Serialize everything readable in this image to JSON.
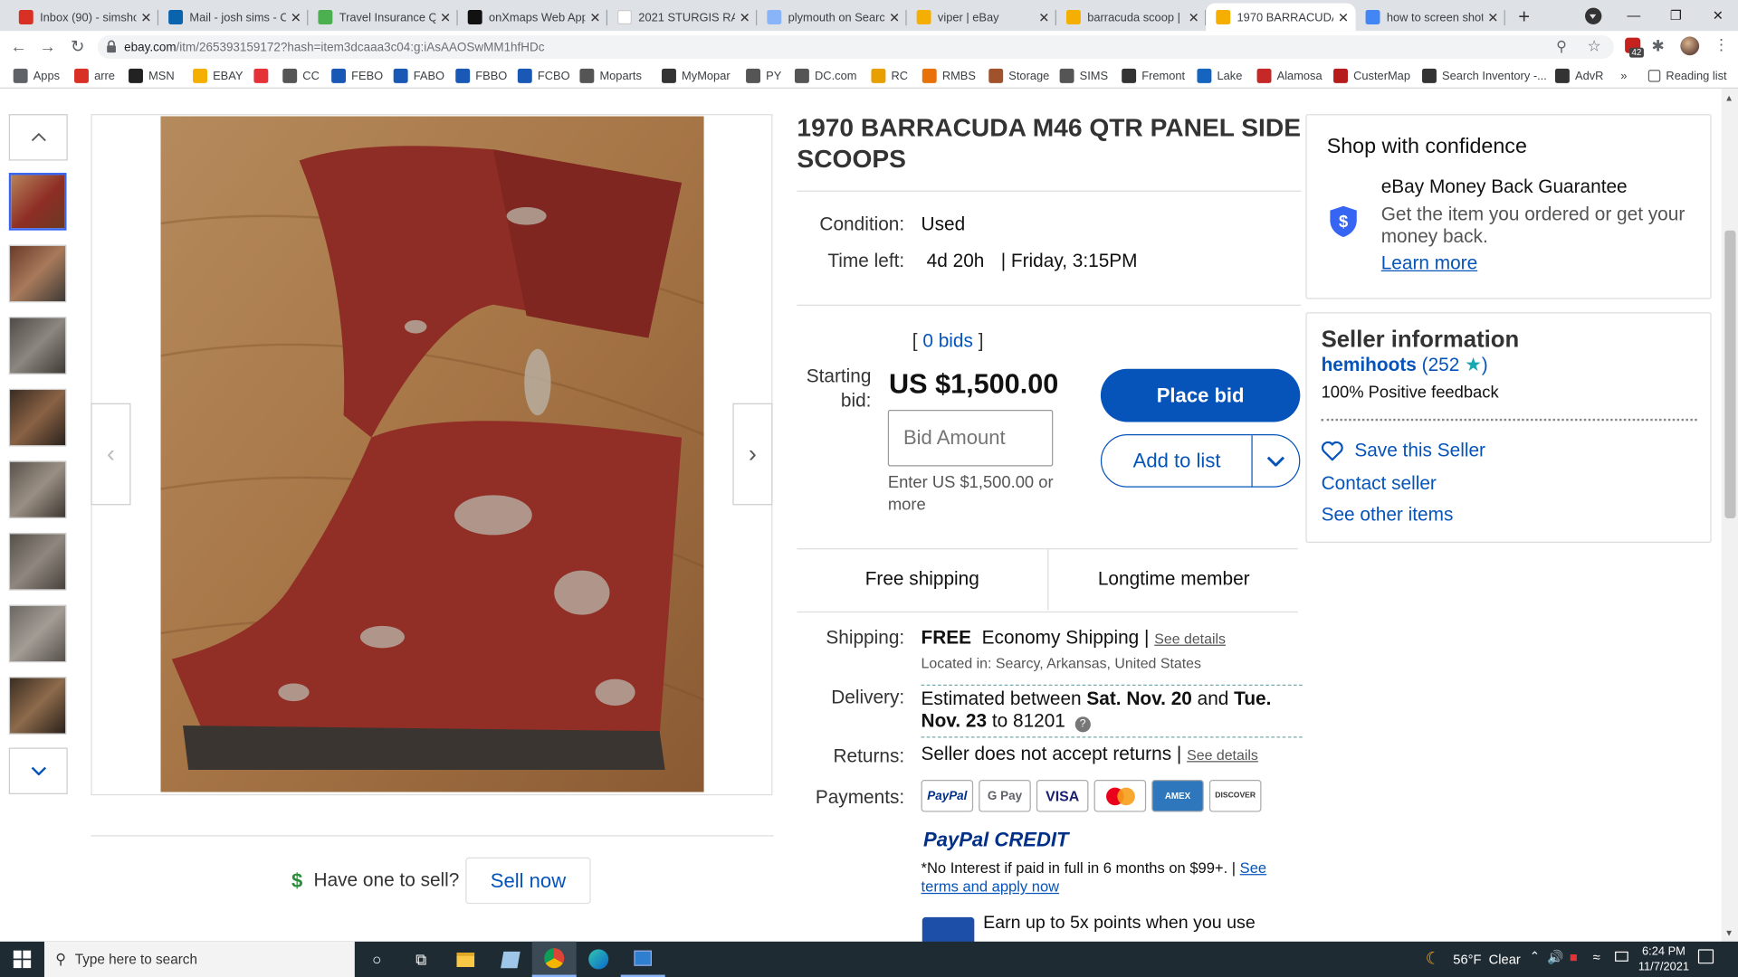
{
  "browser": {
    "tabs": [
      {
        "title": "Inbox (90) - simsho",
        "favicon": "gmail-icon",
        "color": "#d93025"
      },
      {
        "title": "Mail - josh sims - O",
        "favicon": "outlook-icon",
        "color": "#0a64ad"
      },
      {
        "title": "Travel Insurance Q",
        "favicon": "insurance-icon",
        "color": "#4caf50"
      },
      {
        "title": "onXmaps Web App",
        "favicon": "onx-icon",
        "color": "#111111"
      },
      {
        "title": "2021 STURGIS RAL",
        "favicon": "blank-icon",
        "color": "#ffffff"
      },
      {
        "title": "plymouth on Searc",
        "favicon": "search-icon",
        "color": "#8ab4f8"
      },
      {
        "title": "viper | eBay",
        "favicon": "ebay-bag-icon",
        "color": "#f5af02"
      },
      {
        "title": "barracuda scoop |",
        "favicon": "ebay-bag-icon",
        "color": "#f5af02"
      },
      {
        "title": "1970 BARRACUDA",
        "favicon": "ebay-bag-icon",
        "color": "#f5af02"
      },
      {
        "title": "how to screen shot",
        "favicon": "google-icon",
        "color": "#4285f4"
      }
    ],
    "new_tab_label": "+",
    "url_domain": "ebay.com",
    "url_rest": "/itm/265393159172?hash=item3dcaaa3c04:g:iAsAAOSwMM1hfHDc",
    "extension_badge": "42",
    "bookmarks": [
      {
        "label": "Apps",
        "icon": "apps-grid-icon",
        "color": "#5f6368"
      },
      {
        "label": "arre",
        "icon": "gmail-icon",
        "color": "#d93025"
      },
      {
        "label": "MSN",
        "icon": "msn-icon",
        "color": "#222222"
      },
      {
        "label": "EBAY",
        "icon": "ebay-bag-icon",
        "color": "#f5af02"
      },
      {
        "label": "",
        "icon": "e-red-icon",
        "color": "#e53238"
      },
      {
        "label": "CC",
        "icon": "globe-icon",
        "color": "#555555"
      },
      {
        "label": "FEBO",
        "icon": "fb-icon",
        "color": "#1a58b6"
      },
      {
        "label": "FABO",
        "icon": "fb-icon",
        "color": "#1a58b6"
      },
      {
        "label": "FBBO",
        "icon": "fb-icon",
        "color": "#1a58b6"
      },
      {
        "label": "FCBO",
        "icon": "fb-icon",
        "color": "#1a58b6"
      },
      {
        "label": "Moparts",
        "icon": "globe-icon",
        "color": "#555555"
      },
      {
        "label": "MyMopar",
        "icon": "mopar-icon",
        "color": "#333333"
      },
      {
        "label": "PY",
        "icon": "globe-icon",
        "color": "#555555"
      },
      {
        "label": "DC.com",
        "icon": "globe-icon",
        "color": "#555555"
      },
      {
        "label": "RC",
        "icon": "rc-icon",
        "color": "#e8a000"
      },
      {
        "label": "RMBS",
        "icon": "rmbs-icon",
        "color": "#e8710a"
      },
      {
        "label": "Storage",
        "icon": "storage-icon",
        "color": "#a0522d"
      },
      {
        "label": "SIMS",
        "icon": "globe-icon",
        "color": "#555555"
      },
      {
        "label": "Fremont",
        "icon": "fremont-icon",
        "color": "#333333"
      },
      {
        "label": "Lake",
        "icon": "lake-icon",
        "color": "#1565c0"
      },
      {
        "label": "Alamosa",
        "icon": "alamosa-icon",
        "color": "#c62828"
      },
      {
        "label": "CusterMap",
        "icon": "custer-icon",
        "color": "#b71c1c"
      },
      {
        "label": "Search Inventory -...",
        "icon": "inventory-icon",
        "color": "#333333"
      },
      {
        "label": "AdvR",
        "icon": "advr-icon",
        "color": "#333333"
      }
    ],
    "bookmarks_more": "»",
    "reading_list": "Reading list"
  },
  "listing": {
    "title": "1970 BARRACUDA M46 QTR PANEL SIDE SCOOPS",
    "condition_label": "Condition:",
    "condition_value": "Used",
    "timeleft_label": "Time left:",
    "timeleft_value": "4d 20h",
    "timeleft_end": "| Friday, 3:15PM",
    "bids_open": "[",
    "bids_text": "0 bids",
    "bids_close": "]",
    "starting_bid_label_1": "Starting",
    "starting_bid_label_2": "bid:",
    "price": "US $1,500.00",
    "bid_placeholder": "Bid Amount",
    "bid_hint": "Enter US $1,500.00 or more",
    "place_bid": "Place bid",
    "add_to_list": "Add to list",
    "free_shipping": "Free shipping",
    "longtime_member": "Longtime member",
    "shipping_label": "Shipping:",
    "shipping_free": "FREE",
    "shipping_method": "Economy Shipping |",
    "see_details": "See details",
    "located_in": "Located in:  Searcy, Arkansas, United States",
    "delivery_label": "Delivery:",
    "delivery_pre": "Estimated between ",
    "delivery_start": "Sat. Nov. 20",
    "delivery_and": " and ",
    "delivery_end": "Tue. Nov. 23",
    "delivery_to": " to 81201",
    "returns_label": "Returns:",
    "returns_value": "Seller does not accept returns |",
    "returns_see": "See details",
    "payments_label": "Payments:",
    "payment_methods": [
      "PayPal",
      "G Pay",
      "VISA",
      "MC",
      "AMEX",
      "DISCOVER"
    ],
    "paypal_credit": "PayPal CREDIT",
    "paypal_credit_note": "*No Interest if paid in full in 6 months on $99+. |",
    "see_terms": "See terms and apply now",
    "earn_points": "Earn up to 5x points when you use"
  },
  "gallery": {
    "thumb_count": 8,
    "have_one": "Have one to sell?",
    "sell_now": "Sell now"
  },
  "confidence": {
    "heading": "Shop with confidence",
    "guarantee_title": "eBay Money Back Guarantee",
    "guarantee_text": "Get the item you ordered or get your money back.",
    "learn_more": "Learn more"
  },
  "seller": {
    "heading": "Seller information",
    "name": "hemihoots",
    "feedback_count": "252",
    "positive": "100% Positive feedback",
    "save": "Save this Seller",
    "contact": "Contact seller",
    "other_items": "See other items"
  },
  "taskbar": {
    "search_placeholder": "Type here to search",
    "weather": "56°F  Clear",
    "time": "6:24 PM",
    "date": "11/7/2021"
  }
}
